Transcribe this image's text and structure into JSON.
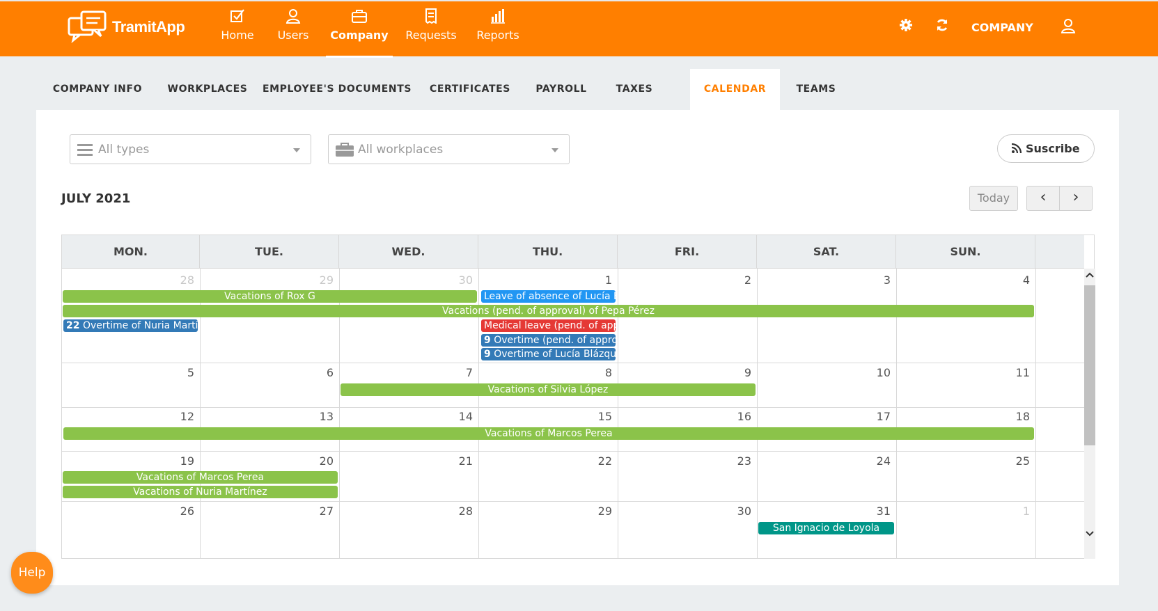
{
  "app": {
    "logo_text": "TramitApp"
  },
  "nav": [
    {
      "label": "Home",
      "icon": "checkbox-icon"
    },
    {
      "label": "Users",
      "icon": "user-icon"
    },
    {
      "label": "Company",
      "icon": "briefcase-icon",
      "active": true
    },
    {
      "label": "Requests",
      "icon": "receipt-icon"
    },
    {
      "label": "Reports",
      "icon": "bar-chart-icon"
    }
  ],
  "topright": {
    "company_label": "COMPANY"
  },
  "tabs": [
    {
      "label": "COMPANY INFO"
    },
    {
      "label": "WORKPLACES"
    },
    {
      "label": "EMPLOYEE'S DOCUMENTS"
    },
    {
      "label": "CERTIFICATES"
    },
    {
      "label": "PAYROLL"
    },
    {
      "label": "TAXES"
    },
    {
      "label": "CALENDAR",
      "active": true
    },
    {
      "label": "TEAMS"
    }
  ],
  "filters": {
    "types": "All types",
    "workplaces": "All workplaces"
  },
  "subscribe_label": "Suscribe",
  "calendar": {
    "month_title": "JULY 2021",
    "today_label": "Today",
    "prev_label": "‹",
    "next_label": "›",
    "days_of_week": [
      "MON.",
      "TUE.",
      "WED.",
      "THU.",
      "FRI.",
      "SAT.",
      "SUN."
    ],
    "weeks": [
      [
        "28",
        "29",
        "30",
        "1",
        "2",
        "3",
        "4"
      ],
      [
        "5",
        "6",
        "7",
        "8",
        "9",
        "10",
        "11"
      ],
      [
        "12",
        "13",
        "14",
        "15",
        "16",
        "17",
        "18"
      ],
      [
        "19",
        "20",
        "21",
        "22",
        "23",
        "24",
        "25"
      ],
      [
        "26",
        "27",
        "28",
        "29",
        "30",
        "31",
        "1"
      ]
    ],
    "events": {
      "rox": "Vacations of Rox G",
      "lucia_leave": "Leave of absence of Lucía Blázquez",
      "pepa": "Vacations (pend. of approval) of Pepa Pérez",
      "nuria_ot_count": "22",
      "nuria_ot": "Overtime of Nuria Martínez",
      "medical": "Medical leave (pend. of approval)",
      "ot_pend_count": "9",
      "ot_pend": "Overtime (pend. of approval)",
      "lucia_ot_count": "9",
      "lucia_ot": "Overtime of Lucía Blázquez",
      "silvia": "Vacations of Silvia López",
      "marcos1": "Vacations of Marcos Perea",
      "marcos2": "Vacations of Marcos Perea",
      "nuria_vac": "Vacations of Nuria Martínez",
      "san_ignacio": "San Ignacio de Loyola"
    }
  },
  "help_label": "Help",
  "colors": {
    "brand": "#ff7f00",
    "vacation": "#8bc34a",
    "leave": "#2196f3",
    "overtime": "#337ab7",
    "medical": "#e53935",
    "holiday": "#009688"
  }
}
